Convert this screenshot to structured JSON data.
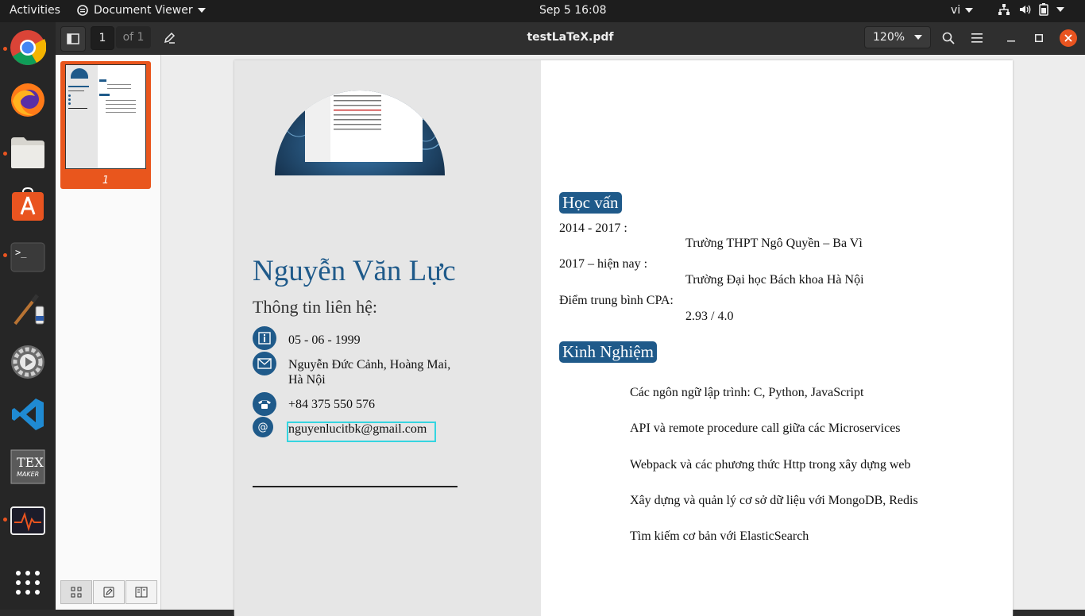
{
  "topbar": {
    "activities": "Activities",
    "app_name": "Document Viewer",
    "clock": "Sep 5  16:08",
    "lang": "vi"
  },
  "dock": {
    "items": [
      "chrome-icon",
      "firefox-icon",
      "files-icon",
      "software-icon",
      "terminal-icon",
      "gimp-icon",
      "settings-icon",
      "vscode-icon",
      "texmaker-icon",
      "system-monitor-icon",
      "apps-grid-icon"
    ]
  },
  "header": {
    "page_number": "1",
    "page_of": "of 1",
    "title": "testLaTeX.pdf",
    "zoom": "120%"
  },
  "sidebar": {
    "thumb_label": "1"
  },
  "cv": {
    "name": "Nguyễn Văn Lực",
    "contact_heading": "Thông tin liên hệ:",
    "birthday": "05 - 06 - 1999",
    "address_line1": "Nguyễn Đức Cảnh, Hoàng Mai,",
    "address_line2": "Hà Nội",
    "phone": "+84 375 550 576",
    "email": "nguyenlucitbk@gmail.com",
    "education_heading": "Học vấn",
    "edu1_period": "2014 - 2017 :",
    "edu1_school": "Trường THPT Ngô Quyền – Ba Vì",
    "edu2_period": "2017 – hiện nay :",
    "edu2_school": "Trường Đại học Bách khoa Hà Nội",
    "cpa_label": "Điểm trung bình CPA:",
    "cpa_value": "2.93 / 4.0",
    "experience_heading": "Kinh Nghiệm",
    "exp": [
      "Các ngôn ngữ lập trình: C, Python, JavaScript",
      "API và remote procedure call giữa các Microservices",
      "Webpack và các phương thức Http trong xây dựng web",
      "Xây dựng và quản lý cơ sở dữ liệu với MongoDB, Redis",
      "Tìm kiếm cơ bản với ElasticSearch"
    ]
  },
  "colors": {
    "accent": "#1f5a8a",
    "selection": "#e9561d",
    "email_highlight": "#35d5e0"
  }
}
